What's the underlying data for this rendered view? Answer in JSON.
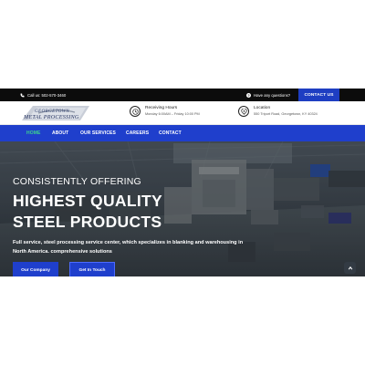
{
  "topbar": {
    "call_text": "Call us: 502-570-3460",
    "question_text": "Have any questions?",
    "contact_button": "CONTACT US"
  },
  "header": {
    "logo_line1": "GEORGETOWN",
    "logo_line2": "METAL PROCESSING",
    "hours": {
      "label": "Receiving Hours",
      "value": "Monday 6:00AM – Friday 10:00 PM"
    },
    "location": {
      "label": "Location",
      "value": "550 Triport Road, Georgetown, KY 40324"
    }
  },
  "nav": {
    "items": [
      {
        "label": "HOME",
        "active": true
      },
      {
        "label": "ABOUT",
        "active": false
      },
      {
        "label": "OUR SERVICES",
        "active": false
      },
      {
        "label": "CAREERS",
        "active": false
      },
      {
        "label": "CONTACT",
        "active": false
      }
    ]
  },
  "hero": {
    "kicker": "CONSISTENTLY OFFERING",
    "headline_line1": "HIGHEST QUALITY",
    "headline_line2": "STEEL PRODUCTS",
    "description": "Full service, steel processing service center, which specializes in blanking and warehousing in North America. comprehensive solutions",
    "button_company": "Our Company",
    "button_touch": "Get In Touch"
  },
  "colors": {
    "topbar_bg": "#0c0c0c",
    "accent_blue": "#1f3fcc",
    "nav_active": "#3dd68c"
  },
  "icons": [
    "phone-icon",
    "question-icon",
    "clock-icon",
    "location-pin-icon",
    "chevron-up-icon"
  ]
}
